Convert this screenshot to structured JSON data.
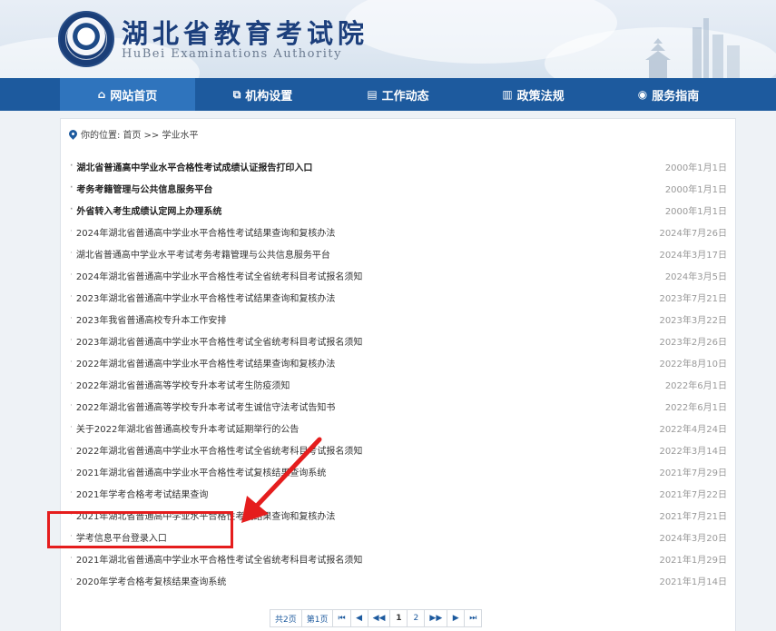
{
  "header": {
    "title": "湖北省教育考试院",
    "subtitle": "HuBei Examinations Authority",
    "logo_icon": "exam-authority-emblem"
  },
  "nav": {
    "items": [
      {
        "label": "网站首页",
        "icon": "home-icon",
        "active": true
      },
      {
        "label": "机构设置",
        "icon": "org-chart-icon",
        "active": false
      },
      {
        "label": "工作动态",
        "icon": "document-icon",
        "active": false
      },
      {
        "label": "政策法规",
        "icon": "book-icon",
        "active": false
      },
      {
        "label": "服务指南",
        "icon": "compass-icon",
        "active": false
      }
    ]
  },
  "breadcrumb": {
    "prefix": "你的位置:",
    "path": "首页 >> 学业水平"
  },
  "articles": [
    {
      "title": "湖北省普通高中学业水平合格性考试成绩认证报告打印入口",
      "date": "2000年1月1日",
      "bold": true
    },
    {
      "title": "考务考籍管理与公共信息服务平台",
      "date": "2000年1月1日",
      "bold": true
    },
    {
      "title": "外省转入考生成绩认定网上办理系统",
      "date": "2000年1月1日",
      "bold": true
    },
    {
      "title": "2024年湖北省普通高中学业水平合格性考试结果查询和复核办法",
      "date": "2024年7月26日",
      "bold": false
    },
    {
      "title": "湖北省普通高中学业水平考试考务考籍管理与公共信息服务平台",
      "date": "2024年3月17日",
      "bold": false
    },
    {
      "title": "2024年湖北省普通高中学业水平合格性考试全省统考科目考试报名须知",
      "date": "2024年3月5日",
      "bold": false
    },
    {
      "title": "2023年湖北省普通高中学业水平合格性考试结果查询和复核办法",
      "date": "2023年7月21日",
      "bold": false
    },
    {
      "title": "2023年我省普通高校专升本工作安排",
      "date": "2023年3月22日",
      "bold": false
    },
    {
      "title": "2023年湖北省普通高中学业水平合格性考试全省统考科目考试报名须知",
      "date": "2023年2月26日",
      "bold": false
    },
    {
      "title": "2022年湖北省普通高中学业水平合格性考试结果查询和复核办法",
      "date": "2022年8月10日",
      "bold": false
    },
    {
      "title": "2022年湖北省普通高等学校专升本考试考生防疫须知",
      "date": "2022年6月1日",
      "bold": false
    },
    {
      "title": "2022年湖北省普通高等学校专升本考试考生诚信守法考试告知书",
      "date": "2022年6月1日",
      "bold": false
    },
    {
      "title": "关于2022年湖北省普通高校专升本考试延期举行的公告",
      "date": "2022年4月24日",
      "bold": false
    },
    {
      "title": "2022年湖北省普通高中学业水平合格性考试全省统考科目考试报名须知",
      "date": "2022年3月14日",
      "bold": false
    },
    {
      "title": "2021年湖北省普通高中学业水平合格性考试复核结果查询系统",
      "date": "2021年7月29日",
      "bold": false
    },
    {
      "title": "2021年学考合格考考试结果查询",
      "date": "2021年7月22日",
      "bold": false
    },
    {
      "title": "2021年湖北省普通高中学业水平合格性考试结果查询和复核办法",
      "date": "2021年7月21日",
      "bold": false
    },
    {
      "title": "学考信息平台登录入口",
      "date": "2024年3月20日",
      "bold": false
    },
    {
      "title": "2021年湖北省普通高中学业水平合格性考试全省统考科目考试报名须知",
      "date": "2021年1月29日",
      "bold": false
    },
    {
      "title": "2020年学考合格考复核结果查询系统",
      "date": "2021年1月14日",
      "bold": false
    }
  ],
  "pager": {
    "total": "共2页",
    "current": "第1页",
    "first": "⏮",
    "prev_group": "◀",
    "prev": "◀◀",
    "page1": "1",
    "page2": "2",
    "next": "▶▶",
    "next_group": "▶",
    "last": "⏭"
  },
  "annotation": {
    "highlight_color": "#e51d1d"
  }
}
